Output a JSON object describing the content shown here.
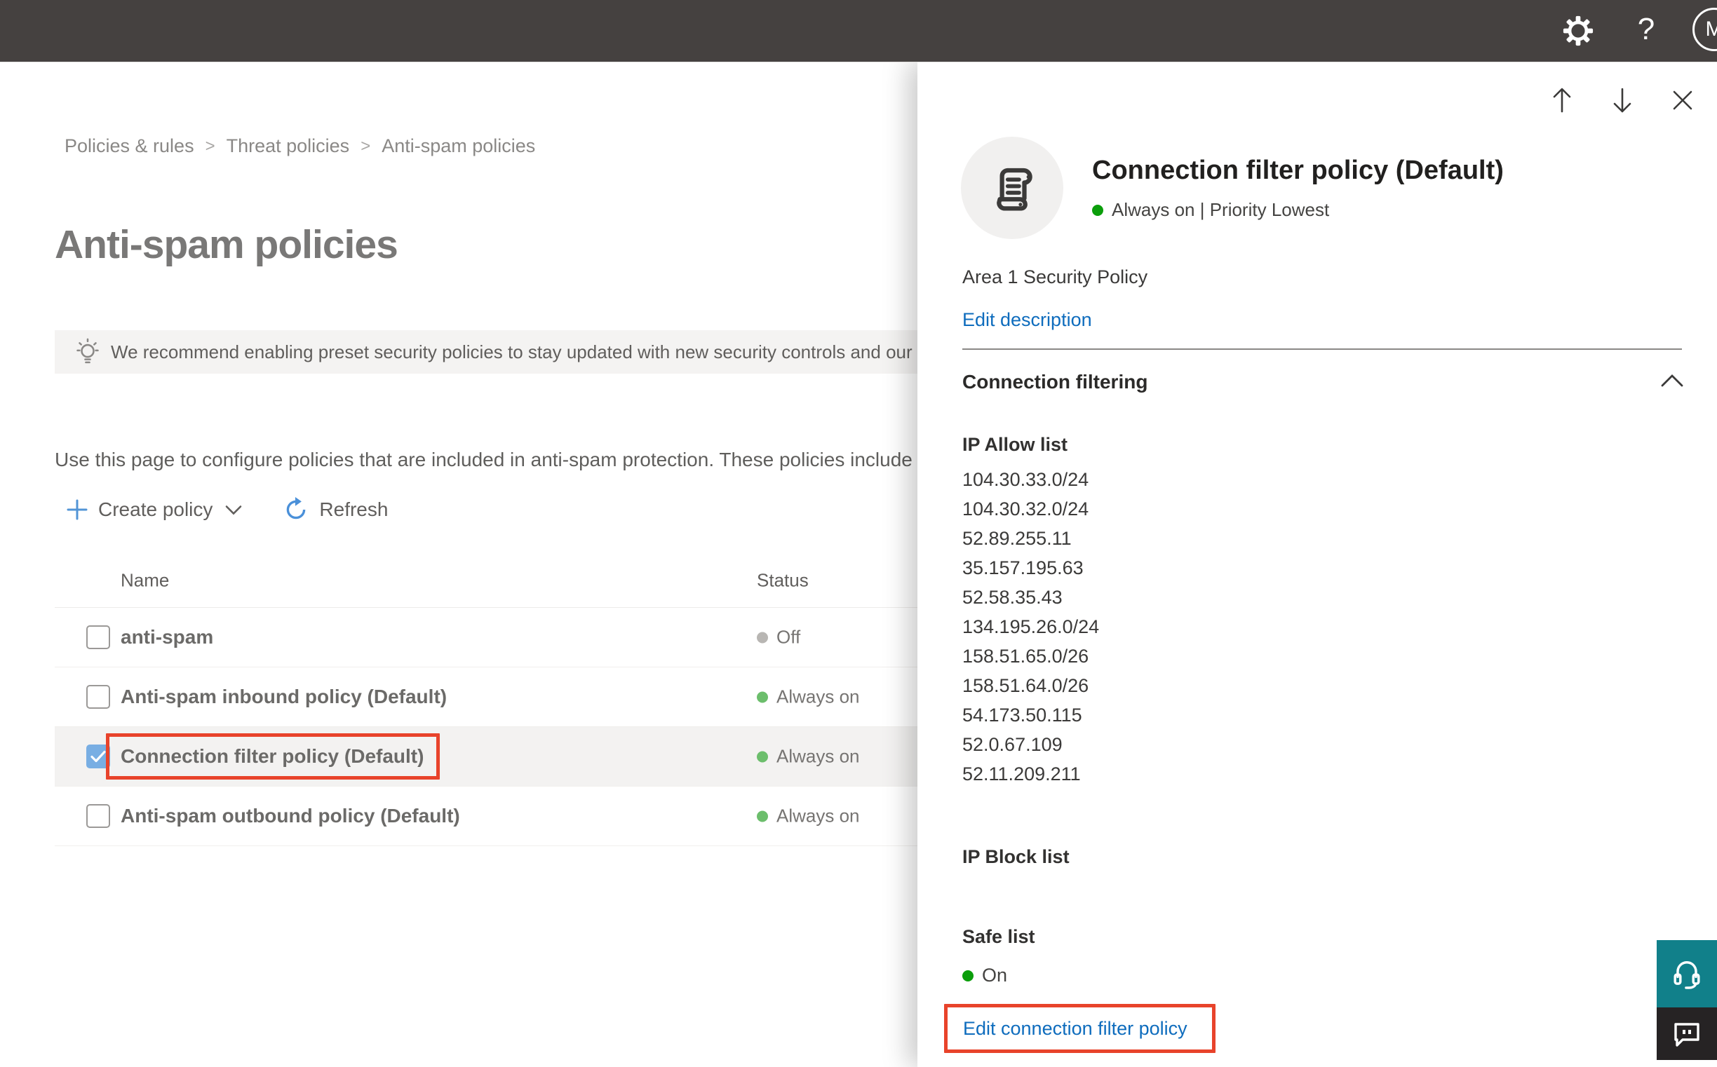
{
  "topbar": {
    "settings_icon": "gear-icon",
    "help_label": "?",
    "avatar_initial": "M"
  },
  "breadcrumb": {
    "items": [
      "Policies & rules",
      "Threat policies",
      "Anti-spam policies"
    ],
    "separator": ">"
  },
  "page": {
    "title": "Anti-spam policies",
    "banner_text": "We recommend enabling preset security policies to stay updated with new security controls and our recomme",
    "description": "Use this page to configure policies that are included in anti-spam protection. These policies include",
    "toolbar": {
      "create_policy_label": "Create policy",
      "refresh_label": "Refresh"
    }
  },
  "table": {
    "columns": {
      "name": "Name",
      "status": "Status"
    },
    "rows": [
      {
        "name": "anti-spam",
        "status": "Off",
        "status_color": "gray",
        "checked": false,
        "selected": false,
        "highlight": false
      },
      {
        "name": "Anti-spam inbound policy (Default)",
        "status": "Always on",
        "status_color": "green",
        "checked": false,
        "selected": false,
        "highlight": false
      },
      {
        "name": "Connection filter policy (Default)",
        "status": "Always on",
        "status_color": "green",
        "checked": true,
        "selected": true,
        "highlight": true
      },
      {
        "name": "Anti-spam outbound policy (Default)",
        "status": "Always on",
        "status_color": "green",
        "checked": false,
        "selected": false,
        "highlight": false
      }
    ]
  },
  "panel": {
    "title": "Connection filter policy (Default)",
    "status_line": "Always on | Priority Lowest",
    "policy_description": "Area 1 Security Policy",
    "edit_description_label": "Edit description",
    "section_title": "Connection filtering",
    "ip_allow": {
      "title": "IP Allow list",
      "ips": [
        "104.30.33.0/24",
        "104.30.32.0/24",
        "52.89.255.11",
        "35.157.195.63",
        "52.58.35.43",
        "134.195.26.0/24",
        "158.51.65.0/26",
        "158.51.64.0/26",
        "54.173.50.115",
        "52.0.67.109",
        "52.11.209.211"
      ]
    },
    "ip_block": {
      "title": "IP Block list"
    },
    "safe_list": {
      "title": "Safe list",
      "status": "On"
    },
    "edit_policy_label": "Edit connection filter policy"
  },
  "colors": {
    "topbar_bg": "#454140",
    "accent_blue": "#0e6cbd",
    "checkbox_blue": "#78aee3",
    "status_green_table": "#6cbe6c",
    "status_green_panel": "#0b9e0b",
    "status_gray": "#b8b6b3",
    "annotation_red": "#e8432b",
    "support_teal": "#11808a",
    "chat_dark": "#262324",
    "selected_row_bg": "#f3f2f1",
    "banner_bg": "#f4f3f2"
  }
}
